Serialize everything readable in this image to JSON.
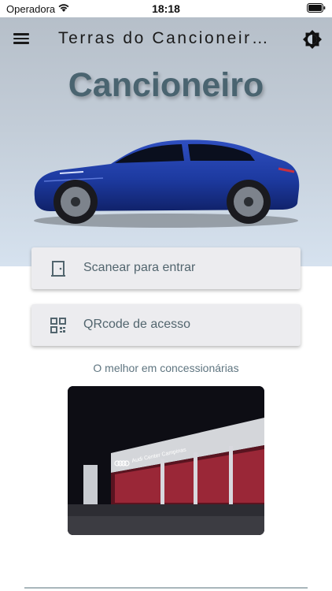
{
  "status_bar": {
    "carrier": "Operadora",
    "time": "18:18"
  },
  "app_bar": {
    "title": "Terras do Cancioneir…",
    "menu_icon": "hamburger-menu-icon",
    "theme_icon": "brightness-icon"
  },
  "hero": {
    "brand": "Cancioneiro",
    "car_color": "#1d3aa0"
  },
  "actions": {
    "scan_label": "Scanear para entrar",
    "scan_icon": "door-icon",
    "qr_label": "QRcode de acesso",
    "qr_icon": "qr-code-icon"
  },
  "tagline": "O melhor em concessionárias",
  "photo": {
    "sign_text": "Audi Center Campinas",
    "brand_logo": "audi-rings-logo"
  },
  "colors": {
    "brand_text": "#4a6470",
    "button_bg": "#ececef",
    "button_text": "#52656e",
    "hero_top": "#b6bfc9",
    "hero_bottom": "#d6e2ef"
  }
}
